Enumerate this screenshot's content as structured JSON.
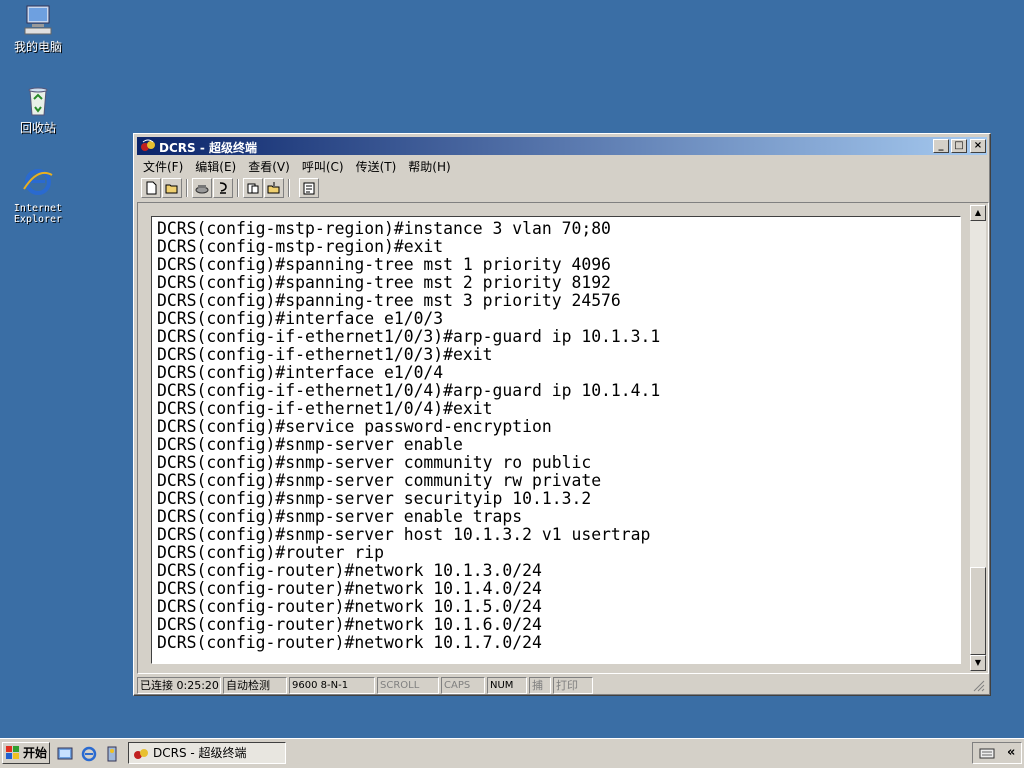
{
  "desktop": {
    "icons": [
      {
        "label": "我的电脑",
        "icon": "my-computer-icon"
      },
      {
        "label": "回收站",
        "icon": "recycle-bin-icon"
      },
      {
        "label": "Internet\nExplorer",
        "icon": "internet-explorer-icon"
      }
    ]
  },
  "window": {
    "title": "DCRS - 超级终端",
    "menu": [
      "文件(F)",
      "编辑(E)",
      "查看(V)",
      "呼叫(C)",
      "传送(T)",
      "帮助(H)"
    ],
    "controls": {
      "minimize": "_",
      "maximize": "□",
      "close": "×"
    }
  },
  "terminal": {
    "lines": [
      "DCRS(config-mstp-region)#instance 3 vlan 70;80",
      "DCRS(config-mstp-region)#exit",
      "DCRS(config)#spanning-tree mst 1 priority 4096",
      "DCRS(config)#spanning-tree mst 2 priority 8192",
      "DCRS(config)#spanning-tree mst 3 priority 24576",
      "DCRS(config)#interface e1/0/3",
      "DCRS(config-if-ethernet1/0/3)#arp-guard ip 10.1.3.1",
      "DCRS(config-if-ethernet1/0/3)#exit",
      "DCRS(config)#interface e1/0/4",
      "DCRS(config-if-ethernet1/0/4)#arp-guard ip 10.1.4.1",
      "DCRS(config-if-ethernet1/0/4)#exit",
      "DCRS(config)#service password-encryption",
      "DCRS(config)#snmp-server enable",
      "DCRS(config)#snmp-server community ro public",
      "DCRS(config)#snmp-server community rw private",
      "DCRS(config)#snmp-server securityip 10.1.3.2",
      "DCRS(config)#snmp-server enable traps",
      "DCRS(config)#snmp-server host 10.1.3.2 v1 usertrap",
      "DCRS(config)#router rip",
      "DCRS(config-router)#network 10.1.3.0/24",
      "DCRS(config-router)#network 10.1.4.0/24",
      "DCRS(config-router)#network 10.1.5.0/24",
      "DCRS(config-router)#network 10.1.6.0/24",
      "DCRS(config-router)#network 10.1.7.0/24"
    ]
  },
  "status": {
    "connected": "已连接 0:25:20",
    "detect": "自动检测",
    "params": "9600 8-N-1",
    "scroll": "SCROLL",
    "caps": "CAPS",
    "num": "NUM",
    "capture": "捕",
    "print": "打印"
  },
  "taskbar": {
    "start": "开始",
    "task_title": "DCRS - 超级终端",
    "tray_arrow": "«"
  },
  "colors": {
    "desktop": "#3a6ea5",
    "title_start": "#0a246a",
    "title_end": "#a6caf0",
    "chrome": "#d4d0c8"
  }
}
